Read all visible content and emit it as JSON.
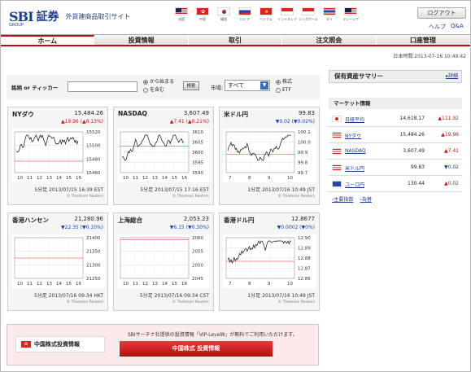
{
  "header": {
    "logo_main": "SBI",
    "logo_small": "GROUP",
    "logo_jp": "証券",
    "subtitle": "外貨建商品取引サイト",
    "login": "ログアウト",
    "help": "ヘルプ",
    "qa": "Q&A",
    "flags": [
      {
        "label": "米国",
        "icon": "us-flag-icon"
      },
      {
        "label": "中国",
        "icon": "hk-flag-icon"
      },
      {
        "label": "韓国",
        "icon": "kr-flag-icon"
      },
      {
        "label": "ロシア",
        "icon": "ru-flag-icon"
      },
      {
        "label": "ベトナム",
        "icon": "vn-flag-icon"
      },
      {
        "label": "インドネシア",
        "icon": "id-flag-icon"
      },
      {
        "label": "シンガポール",
        "icon": "sg-flag-icon"
      },
      {
        "label": "タイ",
        "icon": "th-flag-icon"
      },
      {
        "label": "マレーシア",
        "icon": "my-flag-icon"
      }
    ]
  },
  "nav": {
    "items": [
      "ホーム",
      "投資情報",
      "取引",
      "注文照会",
      "口座管理"
    ]
  },
  "timestamp": "日本時間:2013-07-16 10:49:42",
  "search": {
    "label": "銘柄 or ティッカー",
    "opt1": "から始まる",
    "opt2": "を含む",
    "button": "検索",
    "market_label": "市場:",
    "market_value": "すべて",
    "type1": "株式",
    "type2": "ETF"
  },
  "panels": [
    {
      "title": "NYダウ",
      "value": "15,484.26",
      "change": "▲19.96 (▲0.13%)",
      "dir": "up",
      "foot": "5分足 2013/07/15 16:39 EST",
      "reuters": "© Thomson Reuters",
      "yticks": [
        "15520",
        "15500",
        "15480",
        "15460"
      ],
      "xticks": [
        "10",
        "11",
        "12",
        "13",
        "14",
        "15",
        "16"
      ]
    },
    {
      "title": "NASDAQ",
      "value": "3,607.49",
      "change": "▲7.41 (▲0.21%)",
      "dir": "up",
      "foot": "5分足 2013/07/15 17:16 EST",
      "reuters": "© Thomson Reuters",
      "yticks": [
        "3610",
        "3605",
        "3600",
        "3595",
        "3590"
      ],
      "xticks": [
        "10",
        "11",
        "12",
        "13",
        "14",
        "15",
        "16"
      ]
    },
    {
      "title": "米ドル円",
      "value": "99.83",
      "change": "▼0.02 (▼0.02%)",
      "dir": "down",
      "foot": "1分足 2013/07/16 10:49 JST",
      "reuters": "© Thomson Reuters",
      "yticks": [
        "100.1",
        "100.0",
        "99.9",
        "99.8",
        "99.7"
      ],
      "xticks": [
        "7",
        "8",
        "9",
        "10"
      ]
    },
    {
      "title": "香港ハンセン",
      "value": "21,280.96",
      "change": "▼22.35 (▼0.10%)",
      "dir": "down",
      "foot": "5分足 2013/07/16 09:34 HKT",
      "reuters": "© Thomson Reuters",
      "yticks": [
        "21400",
        "21350",
        "21300",
        "21250"
      ],
      "xticks": [
        "10",
        "11",
        "12",
        "13",
        "14",
        "15",
        "16"
      ]
    },
    {
      "title": "上海総合",
      "value": "2,053.23",
      "change": "▼6.15 (▼0.30%)",
      "dir": "down",
      "foot": "5分足 2013/07/16 09:34 CST",
      "reuters": "© Thomson Reuters",
      "yticks": [
        "2060",
        "2055",
        "2050",
        "2045"
      ],
      "xticks": [
        "10",
        "11",
        "12",
        "13",
        "14",
        "15",
        "16"
      ]
    },
    {
      "title": "香港ドル円",
      "value": "12.8677",
      "change": "▼0.0002 (▼0%)",
      "dir": "down",
      "foot": "1分足 2013/07/16 10:49 JST",
      "reuters": "© Thomson Reuters",
      "yticks": [
        "12.90",
        "12.89",
        "12.88",
        "12.87",
        "12.86"
      ],
      "xticks": [
        "7",
        "8",
        "9",
        "10"
      ]
    }
  ],
  "sidebar": {
    "holdings_title": "保有資産サマリー",
    "detail": "詳細",
    "market_title": "マーケット情報",
    "rows": [
      {
        "name": "日経平均",
        "value": "14,618.17",
        "change": "▲111.92",
        "dir": "up",
        "icon": "jp-flag-icon"
      },
      {
        "name": "NYダウ",
        "value": "15,484.26",
        "change": "▲19.96",
        "dir": "up",
        "icon": "us-flag-icon"
      },
      {
        "name": "NASDAQ",
        "value": "3,607.49",
        "change": "▲7.41",
        "dir": "up",
        "icon": "us-flag-icon"
      },
      {
        "name": "米ドル円",
        "value": "99.83",
        "change": "▼0.02",
        "dir": "down",
        "icon": "us-flag-icon"
      },
      {
        "name": "ユーロ円",
        "value": "130.44",
        "change": "▲0.02",
        "dir": "up",
        "icon": "eu-flag-icon"
      }
    ],
    "links": [
      "主要指数",
      "為替"
    ]
  },
  "china": {
    "title": "中国株式投資情報",
    "text": "SBIサーチナ社提供の投資情報「VIP-LevelⅢ」が無料でご利用いただけます。",
    "button": "中国株式 投資情報"
  },
  "colors": {
    "accent": "#bc0f0f",
    "brand": "#1c3d8f",
    "up": "#c81414",
    "down": "#1b3fb0"
  }
}
